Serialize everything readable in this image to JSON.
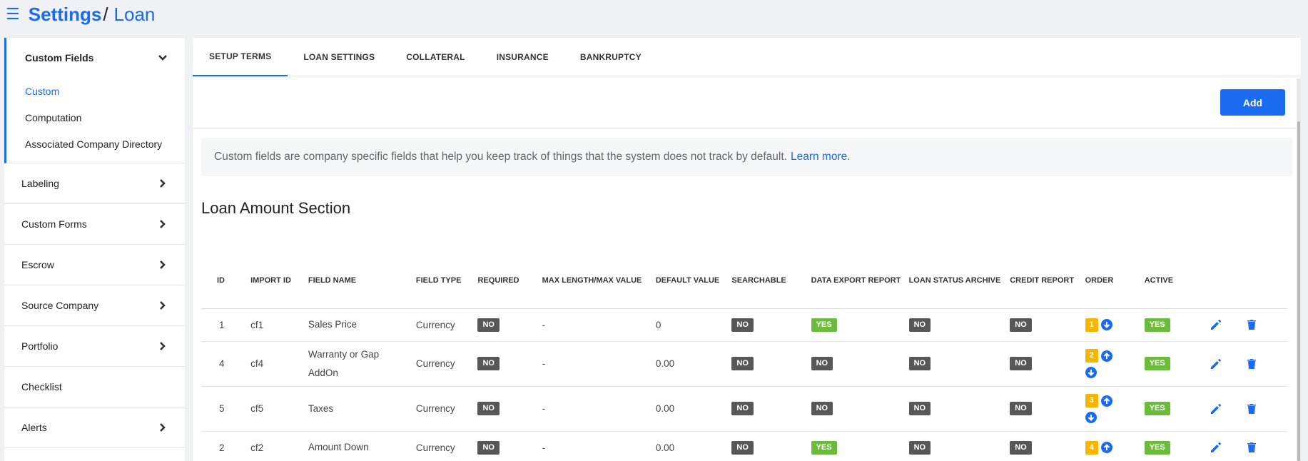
{
  "breadcrumb": {
    "root": "Settings",
    "separator": "/",
    "current": "Loan"
  },
  "sidebar": {
    "group": {
      "label": "Custom Fields",
      "items": [
        {
          "label": "Custom",
          "active": true
        },
        {
          "label": "Computation",
          "active": false
        },
        {
          "label": "Associated Company Directory",
          "active": false
        }
      ]
    },
    "items": [
      {
        "label": "Labeling",
        "has_chevron": true
      },
      {
        "label": "Custom Forms",
        "has_chevron": true
      },
      {
        "label": "Escrow",
        "has_chevron": true
      },
      {
        "label": "Source Company",
        "has_chevron": true
      },
      {
        "label": "Portfolio",
        "has_chevron": true
      },
      {
        "label": "Checklist",
        "has_chevron": false
      },
      {
        "label": "Alerts",
        "has_chevron": true
      }
    ]
  },
  "tabs": [
    {
      "label": "SETUP TERMS",
      "active": true
    },
    {
      "label": "LOAN SETTINGS",
      "active": false
    },
    {
      "label": "COLLATERAL",
      "active": false
    },
    {
      "label": "INSURANCE",
      "active": false
    },
    {
      "label": "BANKRUPTCY",
      "active": false
    }
  ],
  "toolbar": {
    "add_label": "Add"
  },
  "info": {
    "text": "Custom fields are company specific fields that help you keep track of things that the system does not track by default.",
    "link": "Learn more",
    "suffix": "."
  },
  "section_title": "Loan Amount Section",
  "table": {
    "headers": [
      "ID",
      "IMPORT ID",
      "FIELD NAME",
      "FIELD TYPE",
      "REQUIRED",
      "MAX LENGTH/MAX VALUE",
      "DEFAULT VALUE",
      "SEARCHABLE",
      "DATA EXPORT REPORT",
      "LOAN STATUS ARCHIVE",
      "CREDIT REPORT",
      "ORDER",
      "ACTIVE"
    ],
    "rows": [
      {
        "id": "1",
        "import_id": "cf1",
        "field_name": "Sales Price",
        "field_type": "Currency",
        "required": "NO",
        "max": "-",
        "default": "0",
        "searchable": "NO",
        "data_export": "YES",
        "loan_status": "NO",
        "credit": "NO",
        "order": "1",
        "up": false,
        "down": true,
        "active": "YES"
      },
      {
        "id": "4",
        "import_id": "cf4",
        "field_name": "Warranty or Gap AddOn",
        "field_type": "Currency",
        "required": "NO",
        "max": "-",
        "default": "0.00",
        "searchable": "NO",
        "data_export": "NO",
        "loan_status": "NO",
        "credit": "NO",
        "order": "2",
        "up": true,
        "down": true,
        "active": "YES"
      },
      {
        "id": "5",
        "import_id": "cf5",
        "field_name": "Taxes",
        "field_type": "Currency",
        "required": "NO",
        "max": "-",
        "default": "0.00",
        "searchable": "NO",
        "data_export": "NO",
        "loan_status": "NO",
        "credit": "NO",
        "order": "3",
        "up": true,
        "down": true,
        "active": "YES"
      },
      {
        "id": "2",
        "import_id": "cf2",
        "field_name": "Amount Down",
        "field_type": "Currency",
        "required": "NO",
        "max": "-",
        "default": "0.00",
        "searchable": "NO",
        "data_export": "YES",
        "loan_status": "NO",
        "credit": "NO",
        "order": "4",
        "up": true,
        "down": false,
        "active": "YES"
      }
    ]
  },
  "colors": {
    "accent": "#1a6bf0",
    "badge_no": "#575757",
    "badge_yes": "#6dbb3c",
    "badge_order": "#f7b500"
  },
  "icons": {
    "menu": "hamburger-icon",
    "chevron": "chevron-right-icon",
    "expand": "chevron-down-icon",
    "up": "arrow-up-circle-icon",
    "down": "arrow-down-circle-icon",
    "edit": "pencil-icon",
    "delete": "trash-icon"
  }
}
